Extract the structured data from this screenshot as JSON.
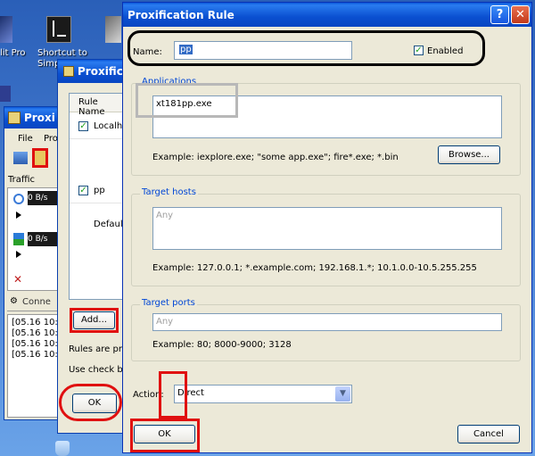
{
  "desktop": {
    "icons": [
      {
        "label": "lit Pro"
      },
      {
        "label": "Shortcut to"
      },
      {
        "label": "Simp"
      }
    ]
  },
  "proxifier_main": {
    "title": "Proxi",
    "menu": [
      "File",
      "Pro"
    ],
    "traffic_label": "Traffic",
    "rates": [
      "0 B/s",
      "0 B/s"
    ],
    "connections_label": "Conne",
    "log_lines": [
      "[05.16 10:",
      "[05.16 10:",
      "[05.16 10:",
      "[05.16 10:"
    ]
  },
  "rules_dialog": {
    "title": "Proxifica",
    "column_header": "Rule Name",
    "rules": [
      {
        "name": "Localho",
        "checked": true
      },
      {
        "name": "pp",
        "checked": true
      },
      {
        "name": "Default",
        "checked": false
      }
    ],
    "add_button": "Add...",
    "info_line1": "Rules are pro",
    "info_line2": "Use check bo",
    "ok_button": "OK"
  },
  "rule_dialog": {
    "title": "Proxification Rule",
    "help_button": "?",
    "close_button": "✕",
    "name_label": "Name:",
    "name_value": "pp",
    "enabled_label": "Enabled",
    "enabled_checked": true,
    "applications": {
      "legend": "Applications",
      "value": "xt181pp.exe",
      "example": "Example: iexplore.exe; \"some app.exe\"; fire*.exe; *.bin",
      "browse_button": "Browse..."
    },
    "target_hosts": {
      "legend": "Target hosts",
      "placeholder": "Any",
      "example": "Example: 127.0.0.1; *.example.com; 192.168.1.*; 10.1.0.0-10.5.255.255"
    },
    "target_ports": {
      "legend": "Target ports",
      "placeholder": "Any",
      "example": "Example: 80; 8000-9000; 3128"
    },
    "action_label": "Action:",
    "action_value": "Direct",
    "ok_button": "OK",
    "cancel_button": "Cancel"
  },
  "colors": {
    "annotation_red": "#e01010",
    "annotation_black": "#000000",
    "annotation_gray": "#b8b8b8",
    "xp_title_blue": "#0a4fd0",
    "dialog_face": "#ece9d8"
  }
}
